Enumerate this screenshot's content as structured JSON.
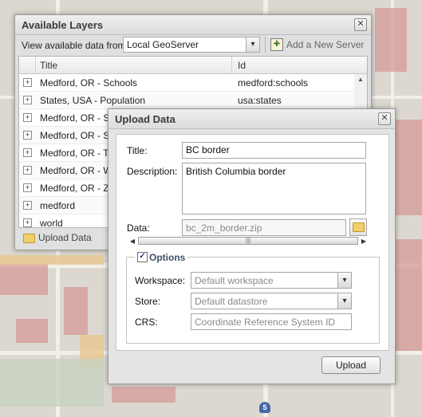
{
  "layers_window": {
    "title": "Available Layers",
    "toolbar": {
      "label": "View available data from:",
      "source_value": "Local GeoServer",
      "add_server_label": "Add a New Server"
    },
    "columns": {
      "title": "Title",
      "id": "Id"
    },
    "rows": [
      {
        "title": "Medford, OR - Schools",
        "id": "medford:schools"
      },
      {
        "title": "States, USA - Population",
        "id": "usa:states"
      },
      {
        "title": "Medford, OR - Ste",
        "id": ""
      },
      {
        "title": "Medford, OR - Str",
        "id": ""
      },
      {
        "title": "Medford, OR - Ta",
        "id": ""
      },
      {
        "title": "Medford, OR - We",
        "id": ""
      },
      {
        "title": "Medford, OR - Zo",
        "id": ""
      },
      {
        "title": "medford",
        "id": ""
      },
      {
        "title": "world",
        "id": ""
      }
    ],
    "footer": {
      "upload_label": "Upload Data"
    }
  },
  "upload_window": {
    "title": "Upload Data",
    "labels": {
      "title": "Title:",
      "description": "Description:",
      "data": "Data:",
      "workspace": "Workspace:",
      "store": "Store:",
      "crs": "CRS:"
    },
    "values": {
      "title": "BC border",
      "description": "British Columbia border",
      "data": "bc_2m_border.zip"
    },
    "options_legend": "Options",
    "options_checked": true,
    "placeholders": {
      "workspace": "Default workspace",
      "store": "Default datastore",
      "crs": "Coordinate Reference System ID"
    },
    "upload_button": "Upload"
  },
  "map": {
    "route_shield": "5"
  },
  "icons": {
    "close": "close-icon",
    "dropdown": "chevron-down-icon",
    "expander": "plus-expander-icon",
    "folder": "folder-icon",
    "add_server": "add-server-icon",
    "checkbox": "checkbox-checked-icon"
  },
  "colors": {
    "window_bg": "#e6e6e6",
    "legend_text": "#3d4f6a",
    "placeholder_text": "#8a8a8a"
  }
}
